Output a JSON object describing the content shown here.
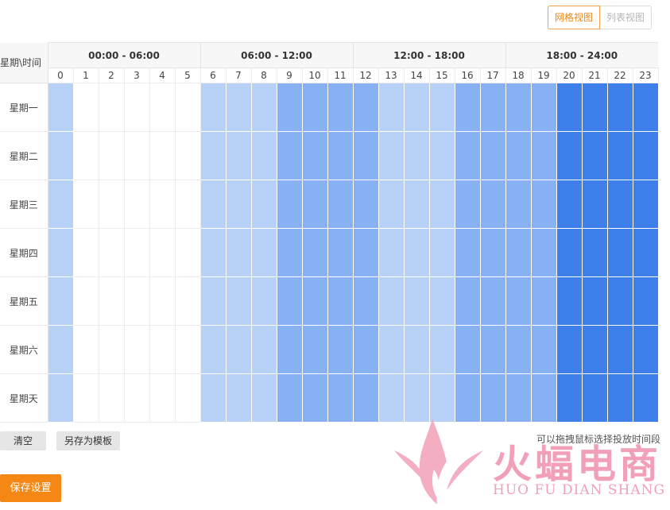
{
  "view_switch": {
    "grid_label": "网格视图",
    "list_label": "列表视图",
    "active": "grid"
  },
  "schedule": {
    "corner_label": "星期\\时间",
    "ranges": [
      "00:00 - 06:00",
      "06:00 - 12:00",
      "12:00 - 18:00",
      "18:00 - 24:00"
    ],
    "hours": [
      "0",
      "1",
      "2",
      "3",
      "4",
      "5",
      "6",
      "7",
      "8",
      "9",
      "10",
      "11",
      "12",
      "13",
      "14",
      "15",
      "16",
      "17",
      "18",
      "19",
      "20",
      "21",
      "22",
      "23"
    ],
    "days": [
      "星期一",
      "星期二",
      "星期三",
      "星期四",
      "星期五",
      "星期六",
      "星期天"
    ],
    "hour_levels": [
      1,
      0,
      0,
      0,
      0,
      0,
      1,
      1,
      1,
      2,
      2,
      2,
      2,
      1,
      1,
      1,
      2,
      2,
      2,
      2,
      4,
      4,
      4,
      4
    ],
    "level_colors": {
      "0": "#ffffff",
      "1": "#b8d1f9",
      "2": "#87b1f3",
      "3": "#4d8bef",
      "4": "#3e7fea"
    }
  },
  "actions": {
    "clear_label": "清空",
    "save_template_label": "另存为模板",
    "save_label": "保存设置"
  },
  "hint": "可以拖拽鼠标选择投放时间段",
  "watermark": {
    "text": "火蝠电商",
    "subtext": "HUO FU DIAN SHANG"
  },
  "colors": {
    "accent": "#f58714",
    "watermark": "#f2a0b8"
  }
}
